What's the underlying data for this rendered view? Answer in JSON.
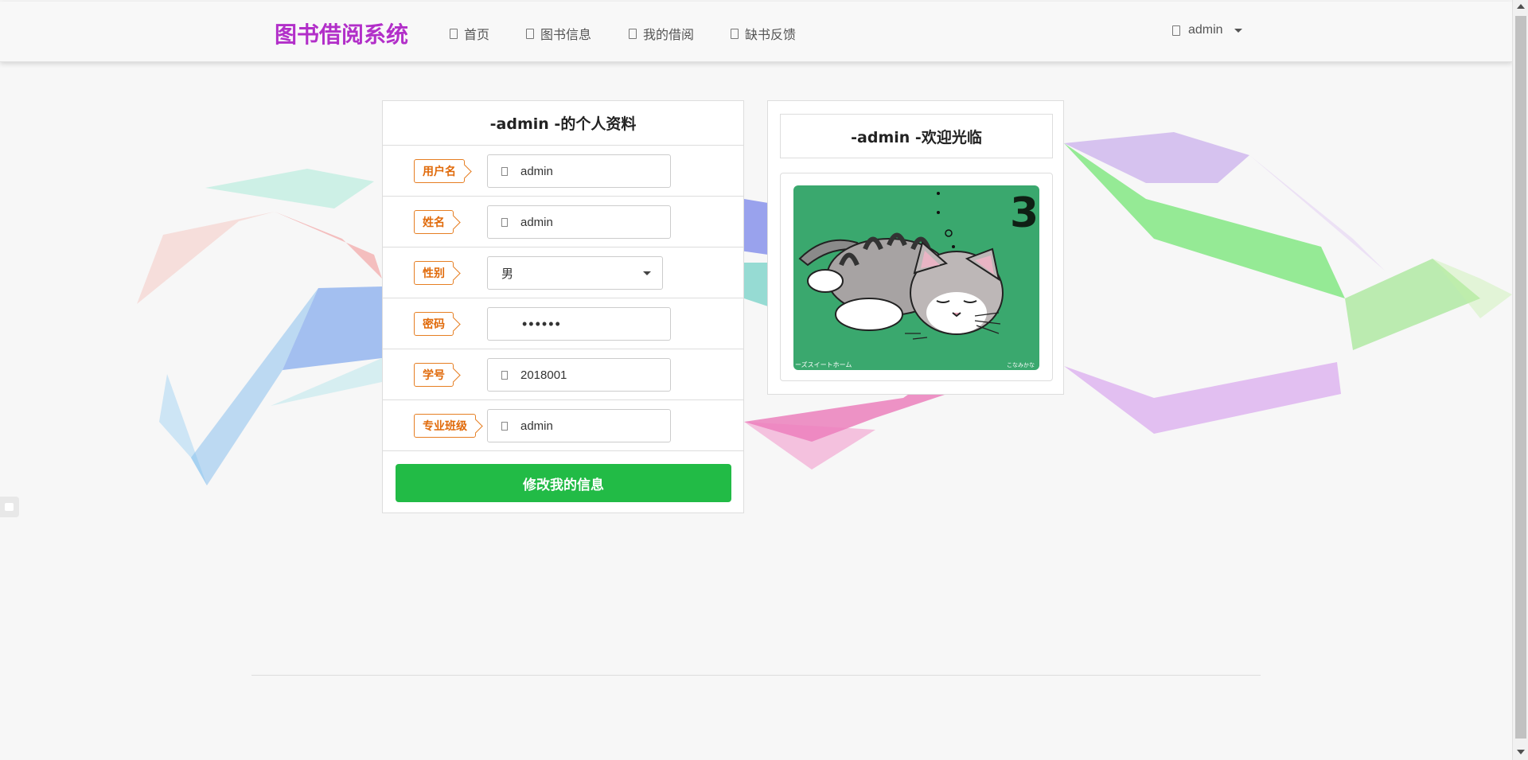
{
  "brand": "图书借阅系统",
  "nav": {
    "items": [
      {
        "label": "首页",
        "icon": "home-icon"
      },
      {
        "label": "图书信息",
        "icon": "book-icon"
      },
      {
        "label": "我的借阅",
        "icon": "list-icon"
      },
      {
        "label": "缺书反馈",
        "icon": "feedback-icon"
      }
    ],
    "user": {
      "label": "admin",
      "icon": "user-icon"
    }
  },
  "profile": {
    "title": "-admin -的个人资料",
    "fields": [
      {
        "label": "用户名",
        "value": "admin",
        "icon": "user-icon"
      },
      {
        "label": "姓名",
        "value": "admin",
        "icon": "user-icon"
      },
      {
        "label": "性别",
        "value": "男"
      },
      {
        "label": "密码",
        "value": "••••••"
      },
      {
        "label": "学号",
        "value": "2018001",
        "icon": "id-icon"
      },
      {
        "label": "专业班级",
        "value": "admin",
        "icon": "class-icon"
      }
    ],
    "submit_label": "修改我的信息"
  },
  "welcome": {
    "title": "-admin -欢迎光临",
    "image": {
      "number": "3",
      "caption_left": "ーズスイートホーム",
      "caption_right": "こなみかな"
    }
  },
  "colors": {
    "brand": "#b22fc9",
    "tag": "#e67e22",
    "submit": "#22bb46",
    "image_bg": "#3aa86e"
  }
}
